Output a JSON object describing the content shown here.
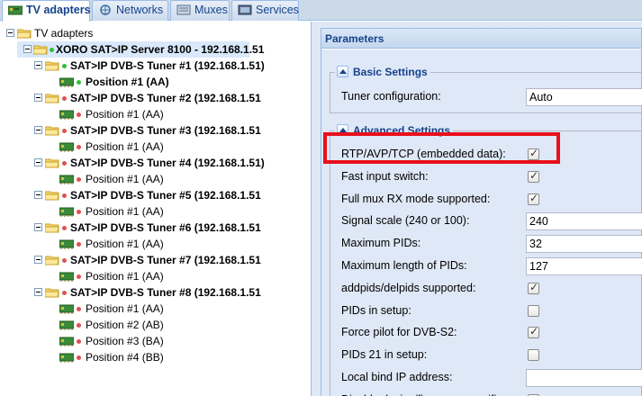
{
  "tabs": [
    {
      "label": "TV adapters",
      "active": true,
      "icon": "tv-adapter-icon"
    },
    {
      "label": "Networks",
      "active": false,
      "icon": "network-icon"
    },
    {
      "label": "Muxes",
      "active": false,
      "icon": "mux-icon"
    },
    {
      "label": "Services",
      "active": false,
      "icon": "services-icon"
    }
  ],
  "tree": {
    "root": "TV adapters",
    "server": "XORO SAT>IP Server 8100 - 192.168.1.51",
    "tuners": [
      {
        "label": "SAT>IP DVB-S Tuner #1 (192.168.1.51)",
        "status": "green",
        "positions": [
          {
            "label": "Position #1 (AA)",
            "status": "green"
          }
        ]
      },
      {
        "label": "SAT>IP DVB-S Tuner #2 (192.168.1.51",
        "status": "red",
        "positions": [
          {
            "label": "Position #1 (AA)",
            "status": "red"
          }
        ]
      },
      {
        "label": "SAT>IP DVB-S Tuner #3 (192.168.1.51",
        "status": "red",
        "positions": [
          {
            "label": "Position #1 (AA)",
            "status": "red"
          }
        ]
      },
      {
        "label": "SAT>IP DVB-S Tuner #4 (192.168.1.51)",
        "status": "red",
        "positions": [
          {
            "label": "Position #1 (AA)",
            "status": "red"
          }
        ]
      },
      {
        "label": "SAT>IP DVB-S Tuner #5 (192.168.1.51",
        "status": "red",
        "positions": [
          {
            "label": "Position #1 (AA)",
            "status": "red"
          }
        ]
      },
      {
        "label": "SAT>IP DVB-S Tuner #6 (192.168.1.51",
        "status": "red",
        "positions": [
          {
            "label": "Position #1 (AA)",
            "status": "red"
          }
        ]
      },
      {
        "label": "SAT>IP DVB-S Tuner #7 (192.168.1.51",
        "status": "red",
        "positions": [
          {
            "label": "Position #1 (AA)",
            "status": "red"
          }
        ]
      },
      {
        "label": "SAT>IP DVB-S Tuner #8 (192.168.1.51",
        "status": "red",
        "positions": [
          {
            "label": "Position #1 (AA)",
            "status": "red"
          },
          {
            "label": "Position #2 (AB)",
            "status": "red"
          },
          {
            "label": "Position #3 (BA)",
            "status": "red"
          },
          {
            "label": "Position #4 (BB)",
            "status": "red"
          }
        ]
      }
    ]
  },
  "panel": {
    "title": "Parameters",
    "basic": {
      "legend": "Basic Settings",
      "tuner_config_label": "Tuner configuration:",
      "tuner_config_value": "Auto"
    },
    "advanced": {
      "legend": "Advanced Settings",
      "fields": [
        {
          "label": "RTP/AVP/TCP (embedded data):",
          "type": "checkbox",
          "checked": true
        },
        {
          "label": "Fast input switch:",
          "type": "checkbox",
          "checked": true
        },
        {
          "label": "Full mux RX mode supported:",
          "type": "checkbox",
          "checked": true
        },
        {
          "label": "Signal scale (240 or 100):",
          "type": "text",
          "value": "240"
        },
        {
          "label": "Maximum PIDs:",
          "type": "text",
          "value": "32"
        },
        {
          "label": "Maximum length of PIDs:",
          "type": "text",
          "value": "127"
        },
        {
          "label": "addpids/delpids supported:",
          "type": "checkbox",
          "checked": true
        },
        {
          "label": "PIDs in setup:",
          "type": "checkbox",
          "checked": false
        },
        {
          "label": "Force pilot for DVB-S2:",
          "type": "checkbox",
          "checked": true
        },
        {
          "label": "PIDs 21 in setup:",
          "type": "checkbox",
          "checked": false
        },
        {
          "label": "Local bind IP address:",
          "type": "text",
          "value": ""
        },
        {
          "label": "Disable device/firmware-specific",
          "type": "checkbox",
          "checked": false
        }
      ]
    }
  },
  "colors": {
    "accent": "#15428b",
    "highlight": "#e8101c",
    "status_green": "#2fbf3a",
    "status_red": "#e05050"
  }
}
